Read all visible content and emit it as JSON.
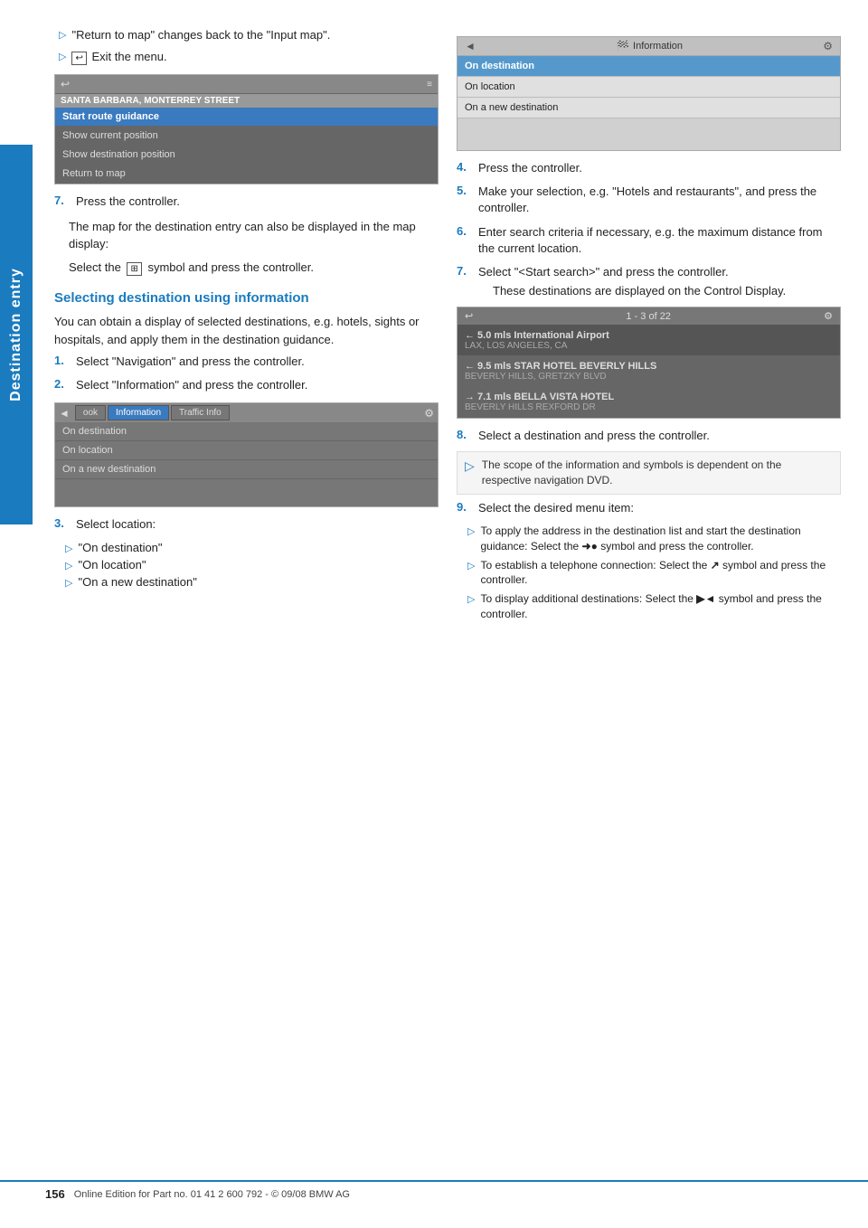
{
  "sidebar": {
    "label": "Destination entry"
  },
  "page": {
    "number": "156",
    "footer_text": "Online Edition for Part no. 01 41 2 600 792 - © 09/08 BMW AG"
  },
  "left_col": {
    "bullet1": "\"Return to map\" changes back to the \"Input map\".",
    "bullet2_prefix": "Exit the menu.",
    "screen1": {
      "address": "SANTA BARBARA, MONTERREY STREET",
      "menu_items": [
        {
          "label": "Start route guidance",
          "selected": true
        },
        {
          "label": "Show current position",
          "selected": false
        },
        {
          "label": "Show destination position",
          "selected": false
        },
        {
          "label": "Return to map",
          "selected": false
        }
      ]
    },
    "step7": {
      "num": "7.",
      "text": "Press the controller."
    },
    "step7_para1": "The map for the destination entry can also be displayed in the map display:",
    "step7_para2_prefix": "Select the",
    "step7_para2_suffix": "symbol and press the controller.",
    "section_heading": "Selecting destination using information",
    "intro_para": "You can obtain a display of selected destinations, e.g. hotels, sights or hospitals, and apply them in the destination guidance.",
    "step1": {
      "num": "1.",
      "text": "Select \"Navigation\" and press the controller."
    },
    "step2": {
      "num": "2.",
      "text": "Select \"Information\" and press the controller."
    },
    "screen2": {
      "tabs": [
        "ook",
        "Information",
        "Traffic Info"
      ],
      "items": [
        {
          "label": "On destination",
          "selected": false
        },
        {
          "label": "On location",
          "selected": false
        },
        {
          "label": "On a new destination",
          "selected": false
        }
      ]
    },
    "step3": {
      "num": "3.",
      "text": "Select location:"
    },
    "sub_items": [
      "\"On destination\"",
      "\"On location\"",
      "\"On a new destination\""
    ]
  },
  "right_col": {
    "screen3": {
      "title": "Information",
      "items": [
        {
          "label": "On destination",
          "type": "highlight"
        },
        {
          "label": "On location",
          "type": "normal"
        },
        {
          "label": "On a new destination",
          "type": "normal"
        }
      ]
    },
    "step4": {
      "num": "4.",
      "text": "Press the controller."
    },
    "step5": {
      "num": "5.",
      "text": "Make your selection, e.g. \"Hotels and restaurants\", and press the controller."
    },
    "step6": {
      "num": "6.",
      "text": "Enter search criteria if necessary, e.g. the maximum distance from the current location."
    },
    "step7_right": {
      "num": "7.",
      "text": "Select \"<Start search>\" and press the controller.",
      "sub": "These destinations are displayed on the Control Display."
    },
    "screen4": {
      "title": "1 - 3 of 22",
      "results": [
        {
          "main": "← 5.0 mls International Airport",
          "sub": "LAX, LOS ANGELES, CA"
        },
        {
          "main": "← 9.5 mls STAR HOTEL BEVERLY HILLS",
          "sub": "BEVERLY HILLS, GRETZKY BLVD"
        },
        {
          "main": "→ 7.1 mls BELLA VISTA HOTEL",
          "sub": "BEVERLY HILLS REXFORD DR"
        }
      ]
    },
    "step8": {
      "num": "8.",
      "text": "Select a destination and press the controller."
    },
    "note": "The scope of the information and symbols is dependent on the respective navigation DVD.",
    "step9": {
      "num": "9.",
      "text": "Select the desired menu item:"
    },
    "sub9_items": [
      {
        "text_prefix": "To apply the address in the destination list and start the destination guidance: Select the",
        "symbol": "➜●",
        "text_suffix": "symbol and press the controller."
      },
      {
        "text_prefix": "To establish a telephone connection: Select the",
        "symbol": "↗",
        "text_suffix": "symbol and press the controller."
      },
      {
        "text_prefix": "To display additional destinations: Select the",
        "symbol": "▶◄",
        "text_suffix": "symbol and press the controller."
      }
    ]
  }
}
